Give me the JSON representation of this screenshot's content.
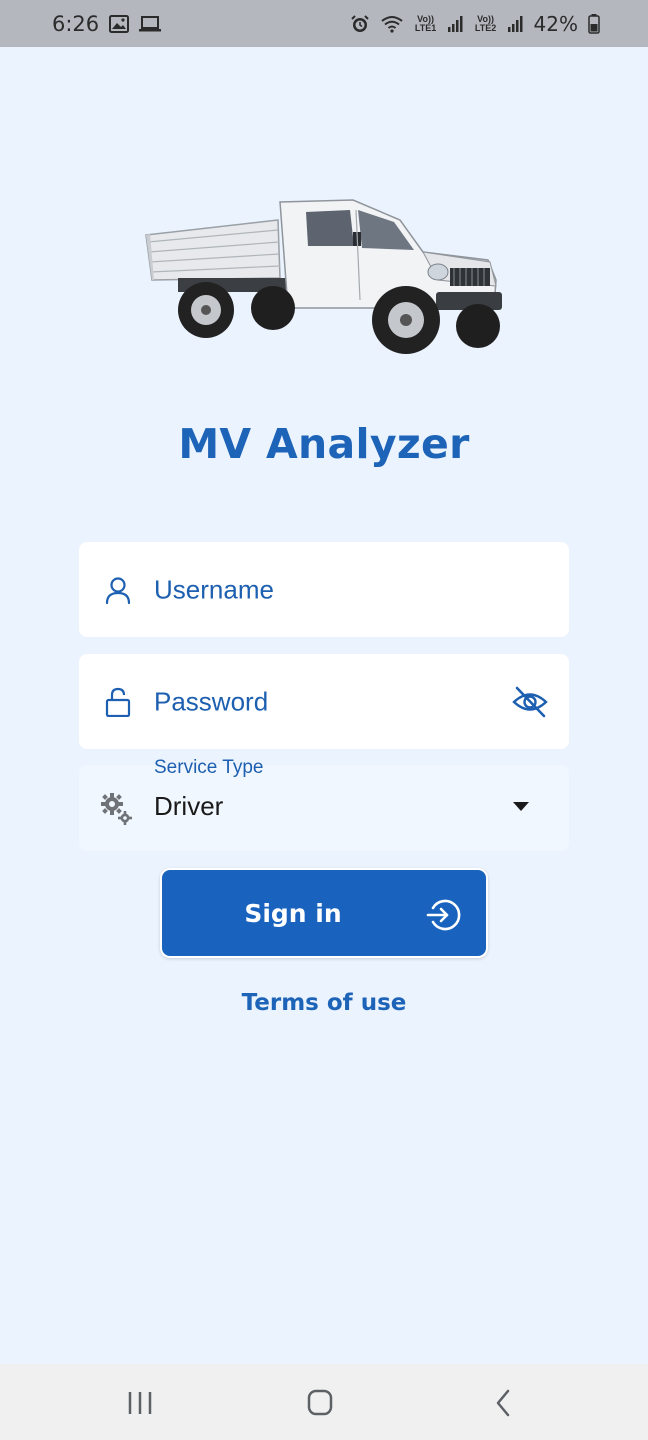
{
  "status_bar": {
    "time": "6:26",
    "lte1": "Vo)) LTE1",
    "lte2": "Vo)) LTE2",
    "battery": "42%"
  },
  "app": {
    "title": "MV Analyzer"
  },
  "form": {
    "username_placeholder": "Username",
    "password_placeholder": "Password",
    "service_label": "Service Type",
    "service_value": "Driver",
    "signin_label": "Sign in",
    "terms_label": "Terms of use"
  },
  "icons": {
    "username": "person-icon",
    "password": "lock-icon",
    "visibility": "eye-off-icon",
    "service": "gears-icon",
    "signin": "login-arrow-icon"
  },
  "colors": {
    "accent": "#1963bf",
    "background": "#eaf3fe",
    "title": "#1d63b7"
  }
}
